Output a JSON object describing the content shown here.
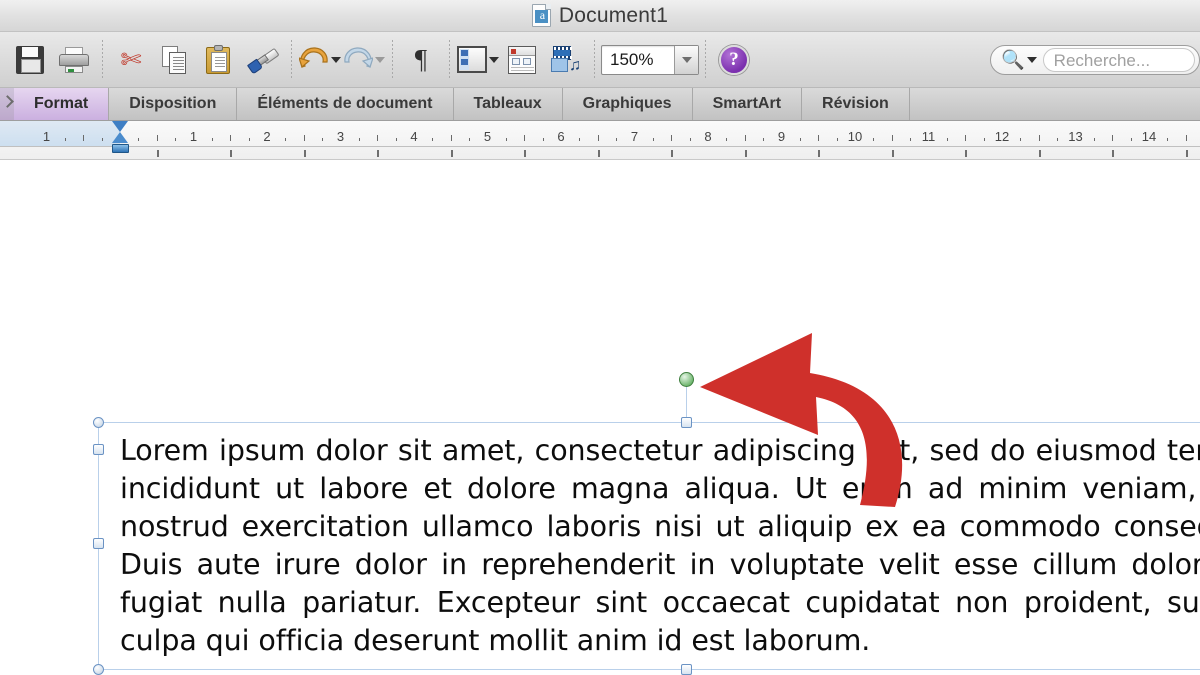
{
  "window": {
    "title": "Document1",
    "doc_icon": "document-icon"
  },
  "toolbar": {
    "buttons": [
      {
        "name": "save",
        "icon": "save-icon",
        "label": "Enregistrer"
      },
      {
        "name": "print",
        "icon": "print-icon",
        "label": "Imprimer"
      },
      {
        "name": "cut",
        "icon": "scissors-icon",
        "label": "Couper"
      },
      {
        "name": "copy",
        "icon": "copy-icon",
        "label": "Copier"
      },
      {
        "name": "paste",
        "icon": "clipboard-icon",
        "label": "Coller"
      },
      {
        "name": "format-painter",
        "icon": "paintbrush-icon",
        "label": "Reproduire la mise en forme"
      },
      {
        "name": "undo",
        "icon": "undo-arrow-icon",
        "label": "Annuler"
      },
      {
        "name": "redo",
        "icon": "redo-arrow-icon",
        "label": "Rétablir"
      },
      {
        "name": "show-marks",
        "icon": "pilcrow-icon",
        "label": "Afficher tout"
      },
      {
        "name": "sidebar",
        "icon": "sidebar-panel-icon",
        "label": "Volet"
      },
      {
        "name": "toolbox",
        "icon": "toolbox-icon",
        "label": "Boîte à outils"
      },
      {
        "name": "media-browser",
        "icon": "media-browser-icon",
        "label": "Navigateur multimédia"
      }
    ],
    "zoom": {
      "value": "150%",
      "icon": "chevron-down-icon"
    },
    "help": {
      "glyph": "?",
      "label": "Aide"
    },
    "search": {
      "placeholder": "Recherche...",
      "icon": "search-icon"
    }
  },
  "ribbon": {
    "tabs": [
      {
        "label": "Format",
        "active": true
      },
      {
        "label": "Disposition",
        "active": false
      },
      {
        "label": "Éléments de document",
        "active": false
      },
      {
        "label": "Tableaux",
        "active": false
      },
      {
        "label": "Graphiques",
        "active": false
      },
      {
        "label": "SmartArt",
        "active": false
      },
      {
        "label": "Révision",
        "active": false
      }
    ]
  },
  "ruler": {
    "unit_labels": [
      "1",
      "1",
      "2",
      "3",
      "4",
      "5",
      "6",
      "7",
      "8",
      "9",
      "10",
      "11",
      "12",
      "13",
      "14"
    ],
    "indent_marker": "left-indent-marker"
  },
  "document": {
    "selection": {
      "state": "selected",
      "rotation_handle": "rotation-handle-green",
      "handle_color": "#6b93c4"
    },
    "body_text": "Lorem ipsum dolor sit amet, consectetur adipiscing elit, sed do eiusmod tempor incididunt ut labore et dolore magna aliqua. Ut enim ad minim veniam, quis nostrud exercitation ullamco laboris nisi ut aliquip ex ea commodo consequat. Duis aute irure dolor in reprehenderit in voluptate velit esse cillum dolore eu fugiat nulla pariatur. Excepteur sint occaecat cupidatat non proident, sunt in culpa qui officia deserunt mollit anim id est laborum."
  },
  "annotation": {
    "arrow": {
      "name": "red-curved-arrow",
      "color": "#cf302b",
      "points_to": "rotation-handle"
    }
  }
}
